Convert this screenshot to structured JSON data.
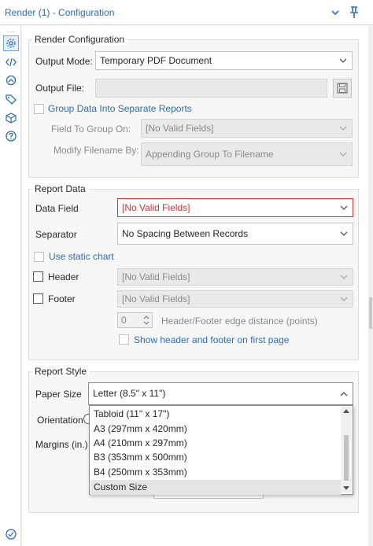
{
  "panel": {
    "title": "Render (1) - Configuration",
    "collapse_icon": "chevron-down-icon",
    "pin_icon": "pin-icon"
  },
  "sidebar": {
    "dots": "...",
    "items": [
      {
        "icon": "gear-icon",
        "active": true
      },
      {
        "icon": "code-icon",
        "active": false
      },
      {
        "icon": "connection-icon",
        "active": false
      },
      {
        "icon": "tag-icon",
        "active": false
      },
      {
        "icon": "cube-icon",
        "active": false
      },
      {
        "icon": "help-icon",
        "active": false
      }
    ],
    "bottom_icon": "check-circle-icon"
  },
  "render_config": {
    "title": "Render Configuration",
    "output_mode_label": "Output Mode:",
    "output_mode_value": "Temporary PDF Document",
    "output_file_label": "Output File:",
    "output_file_value": "",
    "group_data_label": "Group Data Into Separate Reports",
    "group_data_checked": false,
    "field_to_group_label": "Field To Group On:",
    "field_to_group_value": "[No Valid Fields]",
    "modify_filename_label": "Modify Filename By:",
    "modify_filename_value": "Appending Group To Filename"
  },
  "report_data": {
    "title": "Report Data",
    "data_field_label": "Data Field",
    "data_field_value": "[No Valid Fields]",
    "separator_label": "Separator",
    "separator_value": "No Spacing Between Records",
    "static_chart_label": "Use static chart",
    "header_label": "Header",
    "header_value": "[No Valid Fields]",
    "footer_label": "Footer",
    "footer_value": "[No Valid Fields]",
    "edge_distance_value": "0",
    "edge_distance_label": "Header/Footer edge distance (points)",
    "show_first_page_label": "Show header and footer on first page"
  },
  "report_style": {
    "title": "Report Style",
    "paper_size_label": "Paper Size",
    "paper_size_value": "Letter (8.5\" x 11\")",
    "orientation_label": "Orientation",
    "margins_label": "Margins (in.)"
  },
  "paper_dropdown": {
    "options": [
      "Tabloid (11\" x 17\")",
      "A3 (297mm x 420mm)",
      "A4 (210mm x 297mm)",
      "B3 (353mm x 500mm)",
      "B4 (250mm x 353mm)",
      "Custom Size"
    ],
    "selected_index": 5
  },
  "colors": {
    "accent": "#2d6db5",
    "error": "#d13438"
  }
}
